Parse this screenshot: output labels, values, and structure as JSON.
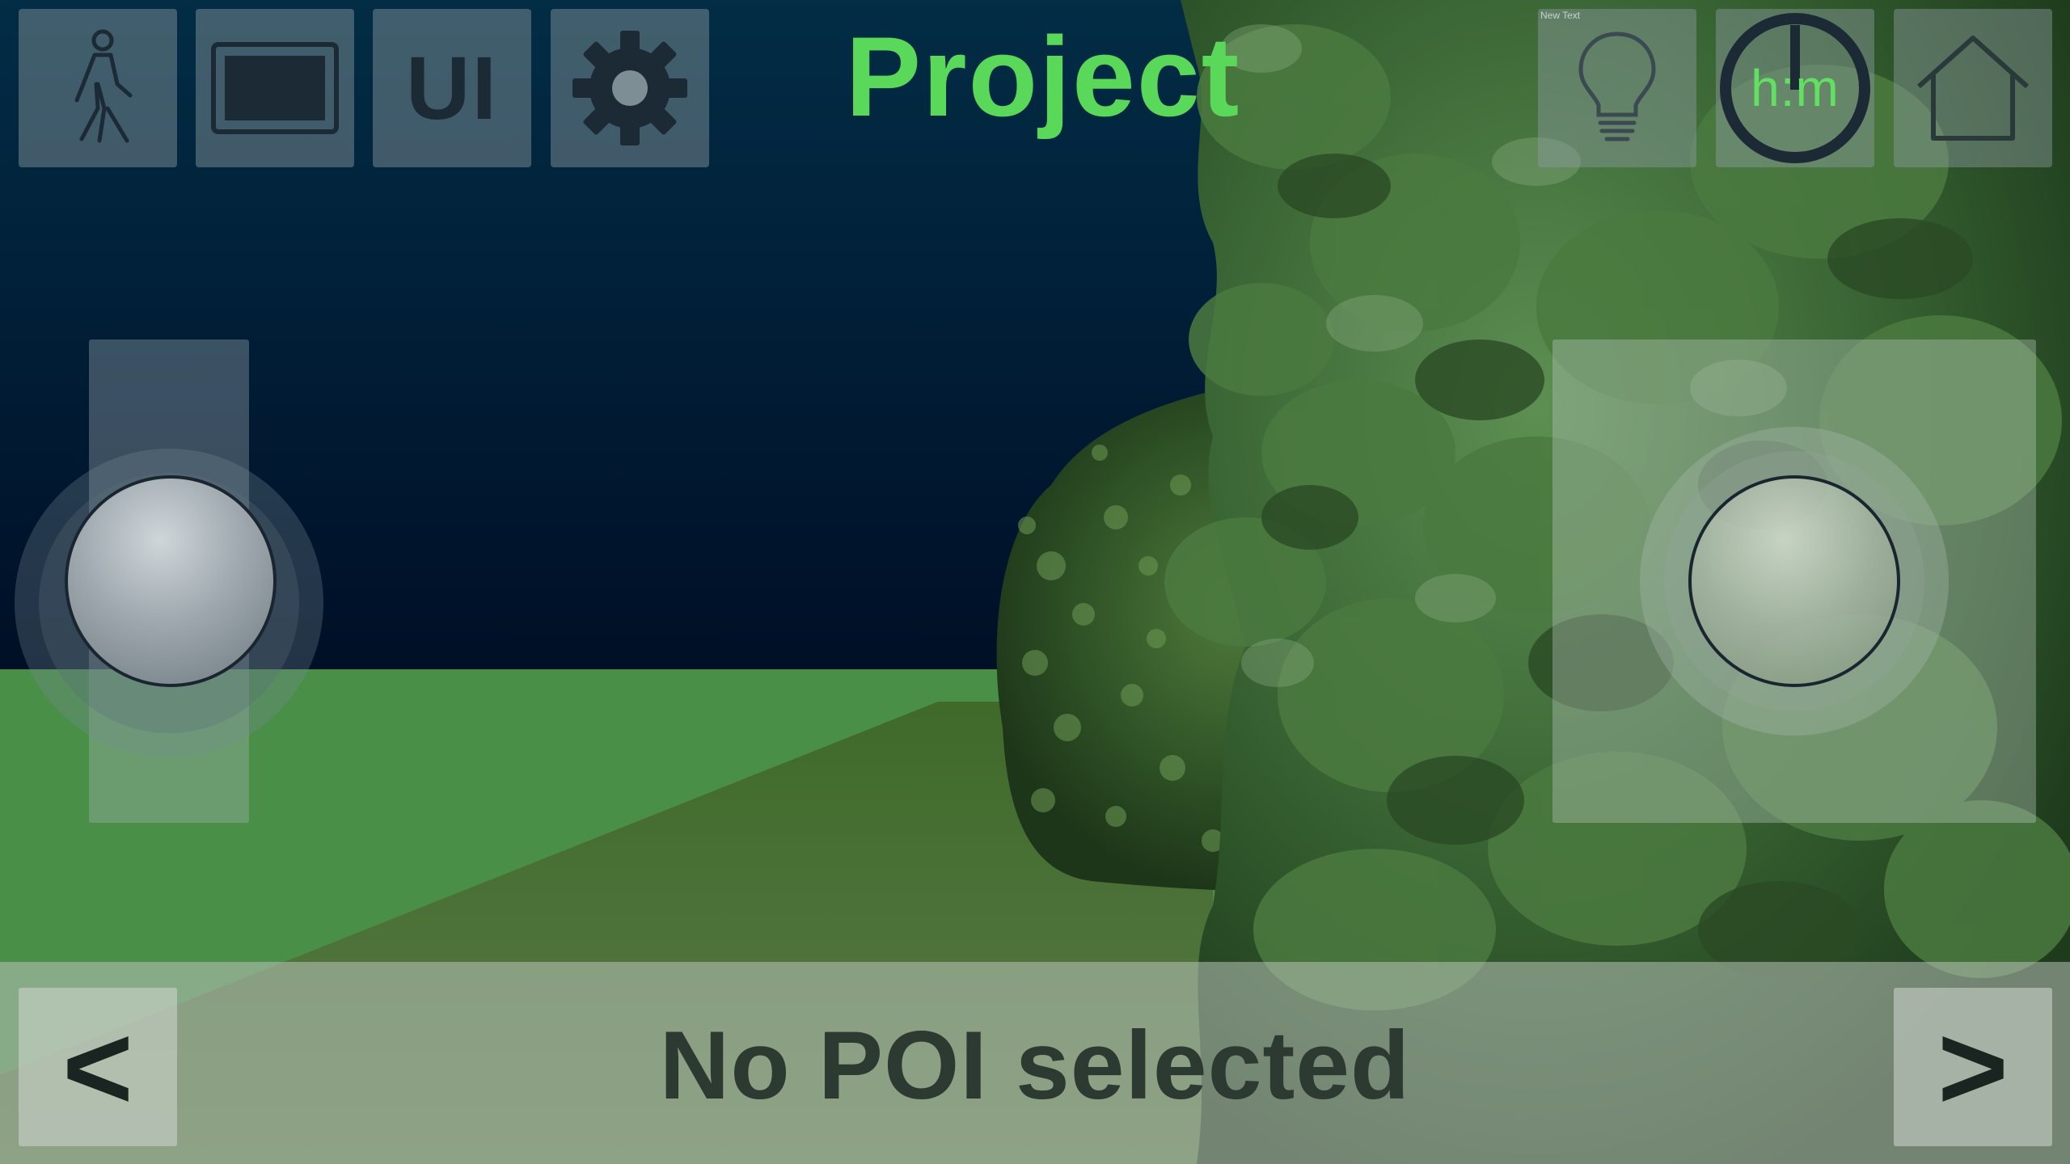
{
  "header": {
    "title": "Project",
    "title_color": "#5ad85a"
  },
  "toolbar_left": [
    {
      "name": "walk-mode",
      "icon": "walking-person-icon"
    },
    {
      "name": "screen-mode",
      "icon": "screen-frame-icon"
    },
    {
      "name": "ui-toggle",
      "icon": "ui-text-icon",
      "label": "UI"
    },
    {
      "name": "settings",
      "icon": "gear-icon"
    }
  ],
  "toolbar_right": [
    {
      "name": "light",
      "icon": "lightbulb-icon",
      "tiny_text": "New Text"
    },
    {
      "name": "time-of-day",
      "icon": "clock-icon",
      "label": "h:m",
      "label_color": "#62e062"
    },
    {
      "name": "home",
      "icon": "house-icon"
    }
  ],
  "joysticks": {
    "left": {
      "icon": "vertical-joystick-knob"
    },
    "right": {
      "icon": "joystick-knob"
    }
  },
  "bottom_bar": {
    "prev_label": "<",
    "next_label": ">",
    "poi_status": "No POI selected"
  },
  "colors": {
    "sky": "#011f38",
    "ground": "#4a8f48",
    "panel": "#8c9ba0"
  }
}
